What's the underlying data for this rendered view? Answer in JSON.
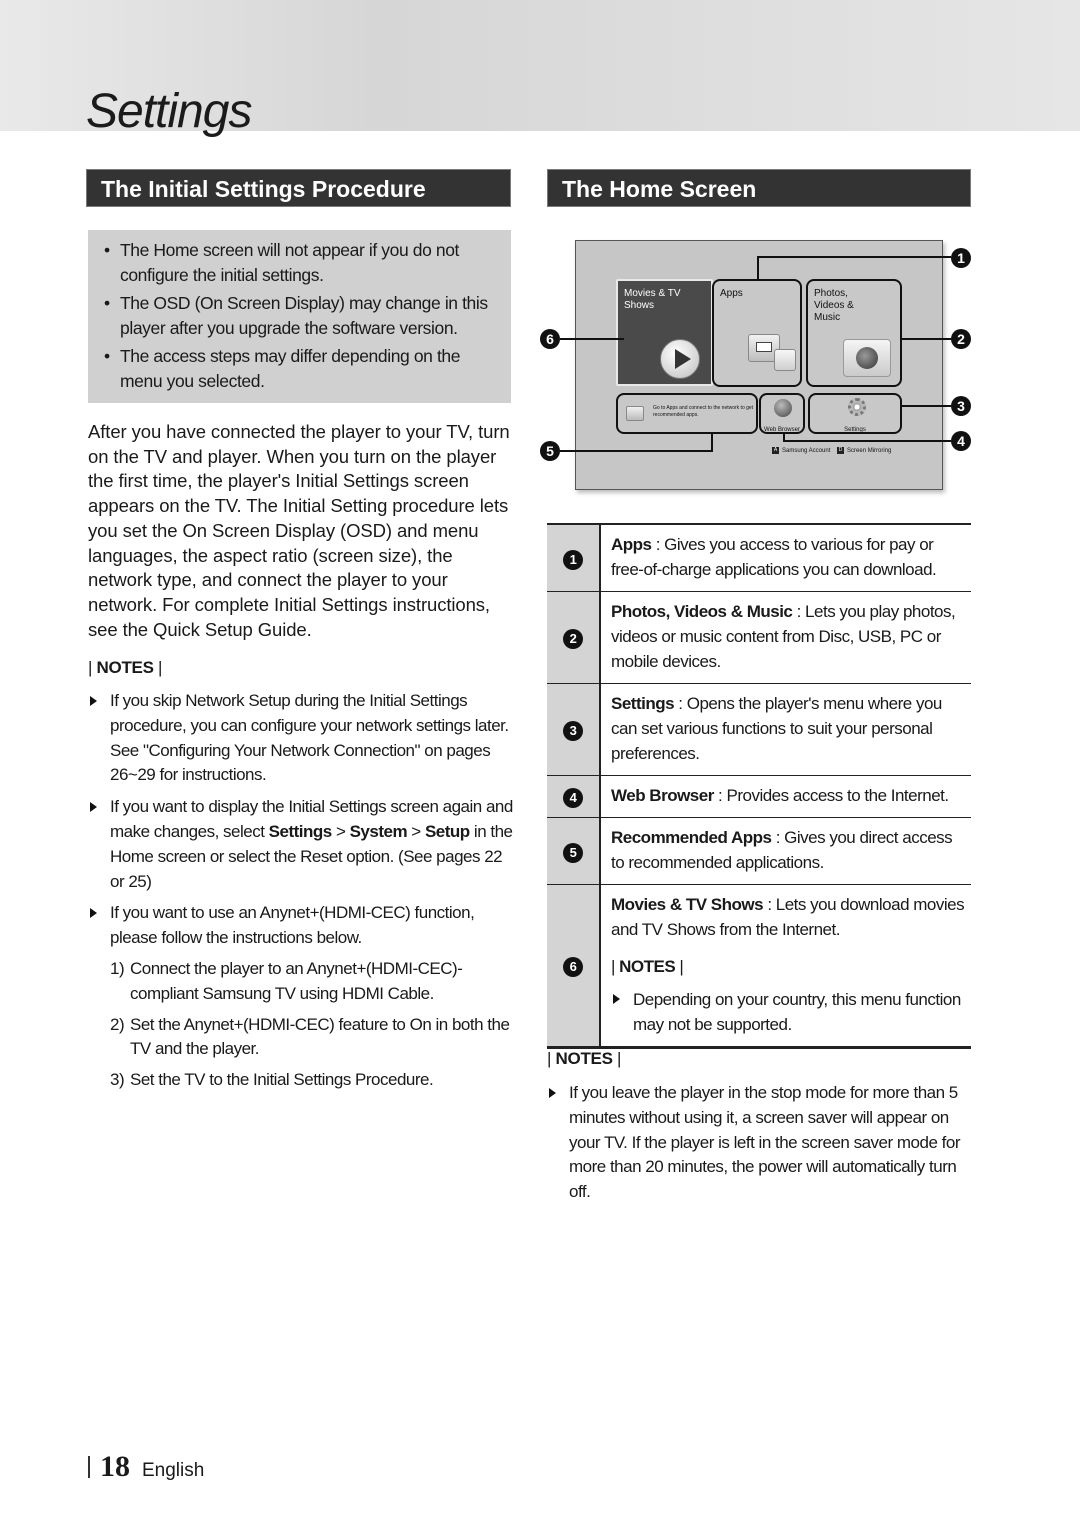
{
  "page": {
    "chapter_title": "Settings",
    "page_number": "18",
    "language": "English"
  },
  "left": {
    "section_title": "The Initial Settings Procedure",
    "cautions": [
      "The Home screen will not appear if you do not configure the initial settings.",
      "The OSD (On Screen Display) may change in this player after you upgrade the software version.",
      "The access steps may differ depending on the menu you selected."
    ],
    "intro": "After you have connected the player to your TV, turn on the TV and player. When you turn on the player the first time, the player's Initial Settings screen appears on the TV. The Initial Setting procedure lets you set the On Screen Display (OSD) and menu languages, the aspect ratio (screen size), the network type, and connect the player to your network. For complete Initial Settings instructions, see the Quick Setup Guide.",
    "notes_label": "NOTES",
    "notes": {
      "n1": "If you skip Network Setup during the Initial Settings procedure, you can configure your network settings later. See \"Configuring Your Network Connection\" on pages 26~29 for instructions.",
      "n2_pre": "If you want to display the Initial Settings screen again and make changes, select ",
      "n2_b1": "Settings",
      "n2_sep1": " > ",
      "n2_b2": "System",
      "n2_sep2": " > ",
      "n2_b3": "Setup",
      "n2_post": " in the Home screen or select the Reset option. (See pages 22 or 25)",
      "n3": "If you want to use an Anynet+(HDMI-CEC) function, please follow the instructions below.",
      "steps": [
        {
          "num": "1)",
          "text": "Connect the player to an Anynet+(HDMI-CEC)-compliant Samsung TV using HDMI Cable."
        },
        {
          "num": "2)",
          "text": "Set the Anynet+(HDMI-CEC) feature to On in both the TV and the player."
        },
        {
          "num": "3)",
          "text": "Set the TV to the Initial Settings Procedure."
        }
      ]
    }
  },
  "right": {
    "section_title": "The Home Screen",
    "screen": {
      "tiles": {
        "movies": "Movies & TV Shows",
        "apps": "Apps",
        "photos": "Photos, Videos & Music",
        "recommended": "Go to Apps and connect to the network to get recommended apps.",
        "web": "Web Browser",
        "settings": "Settings"
      },
      "footer": [
        {
          "key": "A",
          "label": "Samsung Account"
        },
        {
          "key": "D",
          "label": "Screen Mirroring"
        }
      ],
      "callouts": [
        "1",
        "2",
        "3",
        "4",
        "5",
        "6"
      ]
    },
    "table": [
      {
        "num": "1",
        "term": "Apps",
        "desc": " : Gives you access to various for pay or free-of-charge applications you can download."
      },
      {
        "num": "2",
        "term": "Photos, Videos & Music",
        "desc": " : Lets you play photos, videos or music content from Disc, USB, PC or mobile devices."
      },
      {
        "num": "3",
        "term": "Settings",
        "desc": " : Opens the player's menu where you can set various functions to suit your personal preferences."
      },
      {
        "num": "4",
        "term": "Web Browser",
        "desc": " : Provides access to the Internet."
      },
      {
        "num": "5",
        "term": "Recommended Apps",
        "desc": " : Gives you direct access to recommended applications."
      },
      {
        "num": "6",
        "term": "Movies & TV Shows",
        "desc": " : Lets you download movies and TV Shows from the Internet.",
        "notes_label": "NOTES",
        "note": "Depending on your country, this menu function may not be supported."
      }
    ],
    "notes_label": "NOTES",
    "note": "If you leave the player in the stop mode for more than 5 minutes without using it, a screen saver will appear on your TV. If the player is left in the screen saver mode for more than 20 minutes, the power will automatically turn off."
  }
}
